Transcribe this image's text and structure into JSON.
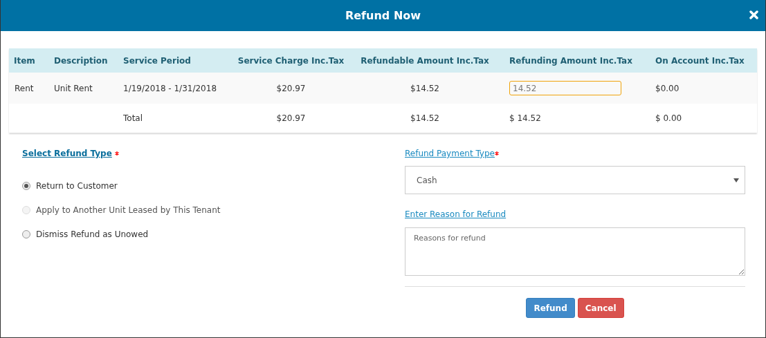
{
  "dialog": {
    "title": "Refund Now"
  },
  "table": {
    "columns": [
      "Item",
      "Description",
      "Service Period",
      "Service Charge Inc.Tax",
      "Refundable Amount Inc.Tax",
      "Refunding Amount Inc.Tax",
      "On Account Inc.Tax"
    ],
    "rows": [
      {
        "kind": "item",
        "cells": [
          {
            "kind": "text",
            "text": "Rent"
          },
          {
            "kind": "text",
            "text": "Unit Rent"
          },
          {
            "kind": "text",
            "text": "1/19/2018 - 1/31/2018"
          },
          {
            "kind": "text",
            "text": "$20.97"
          },
          {
            "kind": "text",
            "text": "$14.52"
          },
          {
            "kind": "input",
            "value": "14.52",
            "focused": true
          },
          {
            "kind": "text",
            "text": "$0.00"
          }
        ]
      },
      {
        "kind": "total",
        "cells": [
          null,
          null,
          {
            "kind": "text",
            "text": "Total"
          },
          {
            "kind": "text",
            "text": "$20.97"
          },
          {
            "kind": "text",
            "text": "$14.52"
          },
          {
            "kind": "text",
            "text": "$ 14.52"
          },
          {
            "kind": "text",
            "text": "$ 0.00"
          }
        ]
      }
    ]
  },
  "refund_type": {
    "label": "Select Refund Type",
    "required": true,
    "options": [
      {
        "label": "Return to Customer",
        "selected": true,
        "disabled": false
      },
      {
        "label": "Apply to Another Unit Leased by This Tenant",
        "selected": false,
        "disabled": true
      },
      {
        "label": "Dismiss Refund as Unowed",
        "selected": false,
        "disabled": false
      }
    ]
  },
  "payment_type": {
    "label": "Refund Payment Type",
    "required": true,
    "value": "Cash"
  },
  "reason": {
    "label": "Enter Reason for Refund",
    "placeholder": "Reasons for refund"
  },
  "buttons": [
    {
      "kind": "primary",
      "label": "Refund"
    },
    {
      "kind": "danger",
      "label": "Cancel"
    }
  ]
}
